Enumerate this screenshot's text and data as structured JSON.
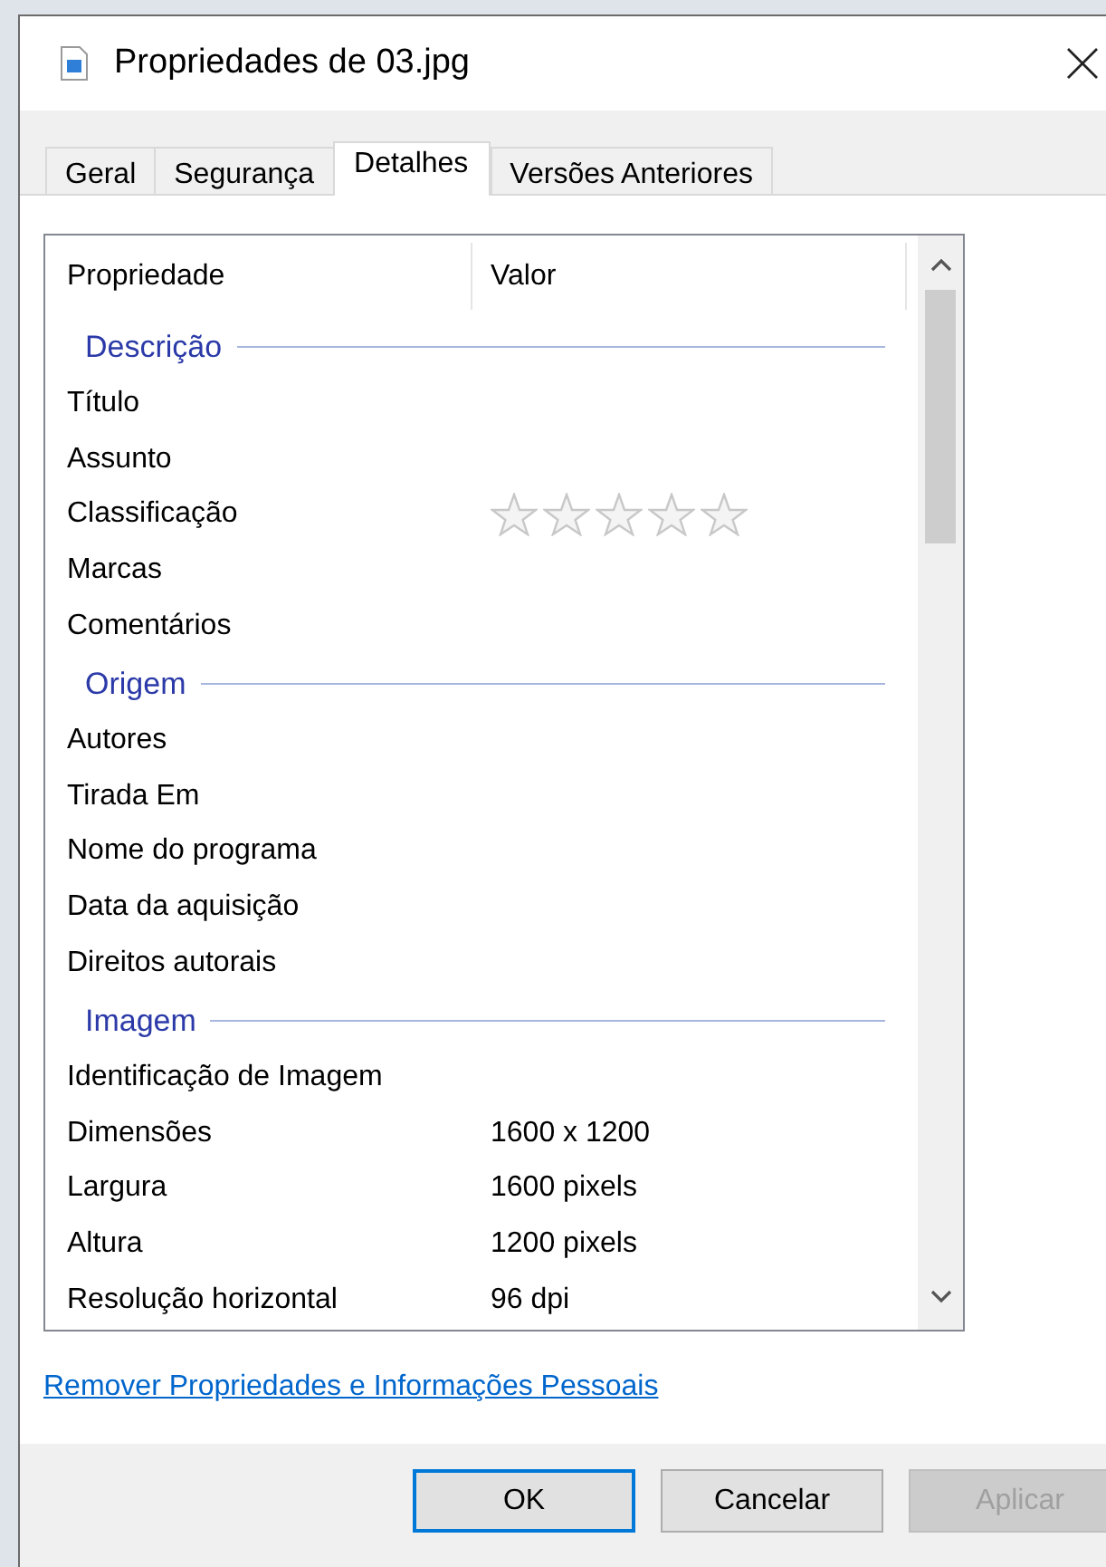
{
  "window": {
    "title": "Propriedades de 03.jpg"
  },
  "tabs": [
    {
      "label": "Geral",
      "selected": false
    },
    {
      "label": "Segurança",
      "selected": false
    },
    {
      "label": "Detalhes",
      "selected": true
    },
    {
      "label": "Versões Anteriores",
      "selected": false
    }
  ],
  "list": {
    "columns": [
      "Propriedade",
      "Valor"
    ],
    "groups": [
      {
        "title": "Descrição",
        "rows": [
          {
            "kind": "text",
            "property": "Título"
          },
          {
            "kind": "text",
            "property": "Assunto"
          },
          {
            "kind": "rating",
            "property": "Classificação",
            "stars": 0
          },
          {
            "kind": "text",
            "property": "Marcas"
          },
          {
            "kind": "text",
            "property": "Comentários"
          }
        ]
      },
      {
        "title": "Origem",
        "rows": [
          {
            "kind": "text",
            "property": "Autores"
          },
          {
            "kind": "text",
            "property": "Tirada Em"
          },
          {
            "kind": "text",
            "property": "Nome do programa"
          },
          {
            "kind": "text",
            "property": "Data da aquisição"
          },
          {
            "kind": "text",
            "property": "Direitos autorais"
          }
        ]
      },
      {
        "title": "Imagem",
        "rows": [
          {
            "kind": "text",
            "property": "Identificação de Imagem"
          },
          {
            "kind": "text",
            "property": "Dimensões",
            "value": "1600 x 1200"
          },
          {
            "kind": "text",
            "property": "Largura",
            "value": "1600 pixels"
          },
          {
            "kind": "text",
            "property": "Altura",
            "value": "1200 pixels"
          },
          {
            "kind": "text",
            "property": "Resolução horizontal",
            "value": "96 dpi"
          }
        ]
      }
    ]
  },
  "link": "Remover Propriedades e Informações Pessoais",
  "buttons": [
    {
      "label": "OK",
      "default": true,
      "disabled": false
    },
    {
      "label": "Cancelar",
      "default": false,
      "disabled": false
    },
    {
      "label": "Aplicar",
      "default": false,
      "disabled": true
    }
  ]
}
